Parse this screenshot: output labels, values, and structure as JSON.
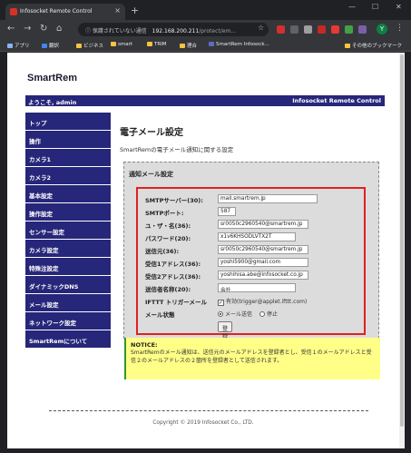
{
  "browser": {
    "tab_title": "Infosocket Remote Control",
    "tab_close": "×",
    "new_tab": "+",
    "window_controls": [
      "—",
      "☐",
      "✕"
    ],
    "url_warning": "ⓘ 保護されていない通信",
    "url_host": "192.168.200.211",
    "url_path": "/protect/em...",
    "profile_initial": "Y",
    "bookmarks": [
      "アプリ",
      "翻訳",
      "ビジネス",
      "smart",
      "TRIM",
      "理合",
      "SmartRem Infosock..."
    ],
    "other_bookmarks": "その他のブックマーク"
  },
  "page": {
    "logo": "SmartRem",
    "welcome": "ようこそ, admin",
    "brand": "Infosocket Remote Control",
    "sidebar": [
      "トップ",
      "操作",
      "カメラ1",
      "カメラ2",
      "基本設定",
      "操作設定",
      "センサー設定",
      "カメラ設定",
      "特殊注設定",
      "ダイナミックDNS",
      "メール設定",
      "ネットワーク設定",
      "SmartRemについて"
    ],
    "section_title": "電子メール設定",
    "section_desc": "SmartRemの電子メール通知に関する設定",
    "panel_title": "通知メール設定",
    "form": {
      "smtp_server_label": "SMTPサーバー(30):",
      "smtp_server_value": "mail.smartrem.jp",
      "smtp_port_label": "SMTPポート:",
      "smtp_port_value": "587",
      "user_label": "ユ・ザ・名(36):",
      "user_value": "sr0050c2960540@smartrem.jp",
      "password_label": "パスワード(20):",
      "password_value": "x1v6KHSODLVTX2T",
      "sender_label": "送信元(36):",
      "sender_value": "sr0050c2960540@smartrem.jp",
      "recipient1_label": "受信1アドレス(36):",
      "recipient1_value": "yoshi5900@gmail.com",
      "recipient2_label": "受信2アドレス(36):",
      "recipient2_value": "yoshihisa.abe@infosocket.co.jp",
      "signature_label": "送信者名称(20):",
      "signature_value": "会社",
      "ifttt_label": "IFTTT トリガーメール",
      "ifttt_option": "有効(trigger@applet.ifttt.com)",
      "ifttt_checked": true,
      "mail_status_label": "メール状態",
      "mail_status_options": [
        "メール送信",
        "停止"
      ],
      "mail_status_selected": "メール送信",
      "save_label": "登録"
    },
    "notice_title": "NOTICE:",
    "notice_body": "SmartRemのメール通知は、送信元のメールアドレスを登録者とし、受信１のメールアドレスと受信２のメールアドレスの２箇所を登録者として送信されます。",
    "footer": "Copyright © 2019 Infosocket Co., LTD."
  },
  "colors": {
    "nav_bg": "#26267a",
    "highlight_border": "#e02020",
    "notice_bg": "#ffff88",
    "panel_bg": "#dcdcdc"
  }
}
